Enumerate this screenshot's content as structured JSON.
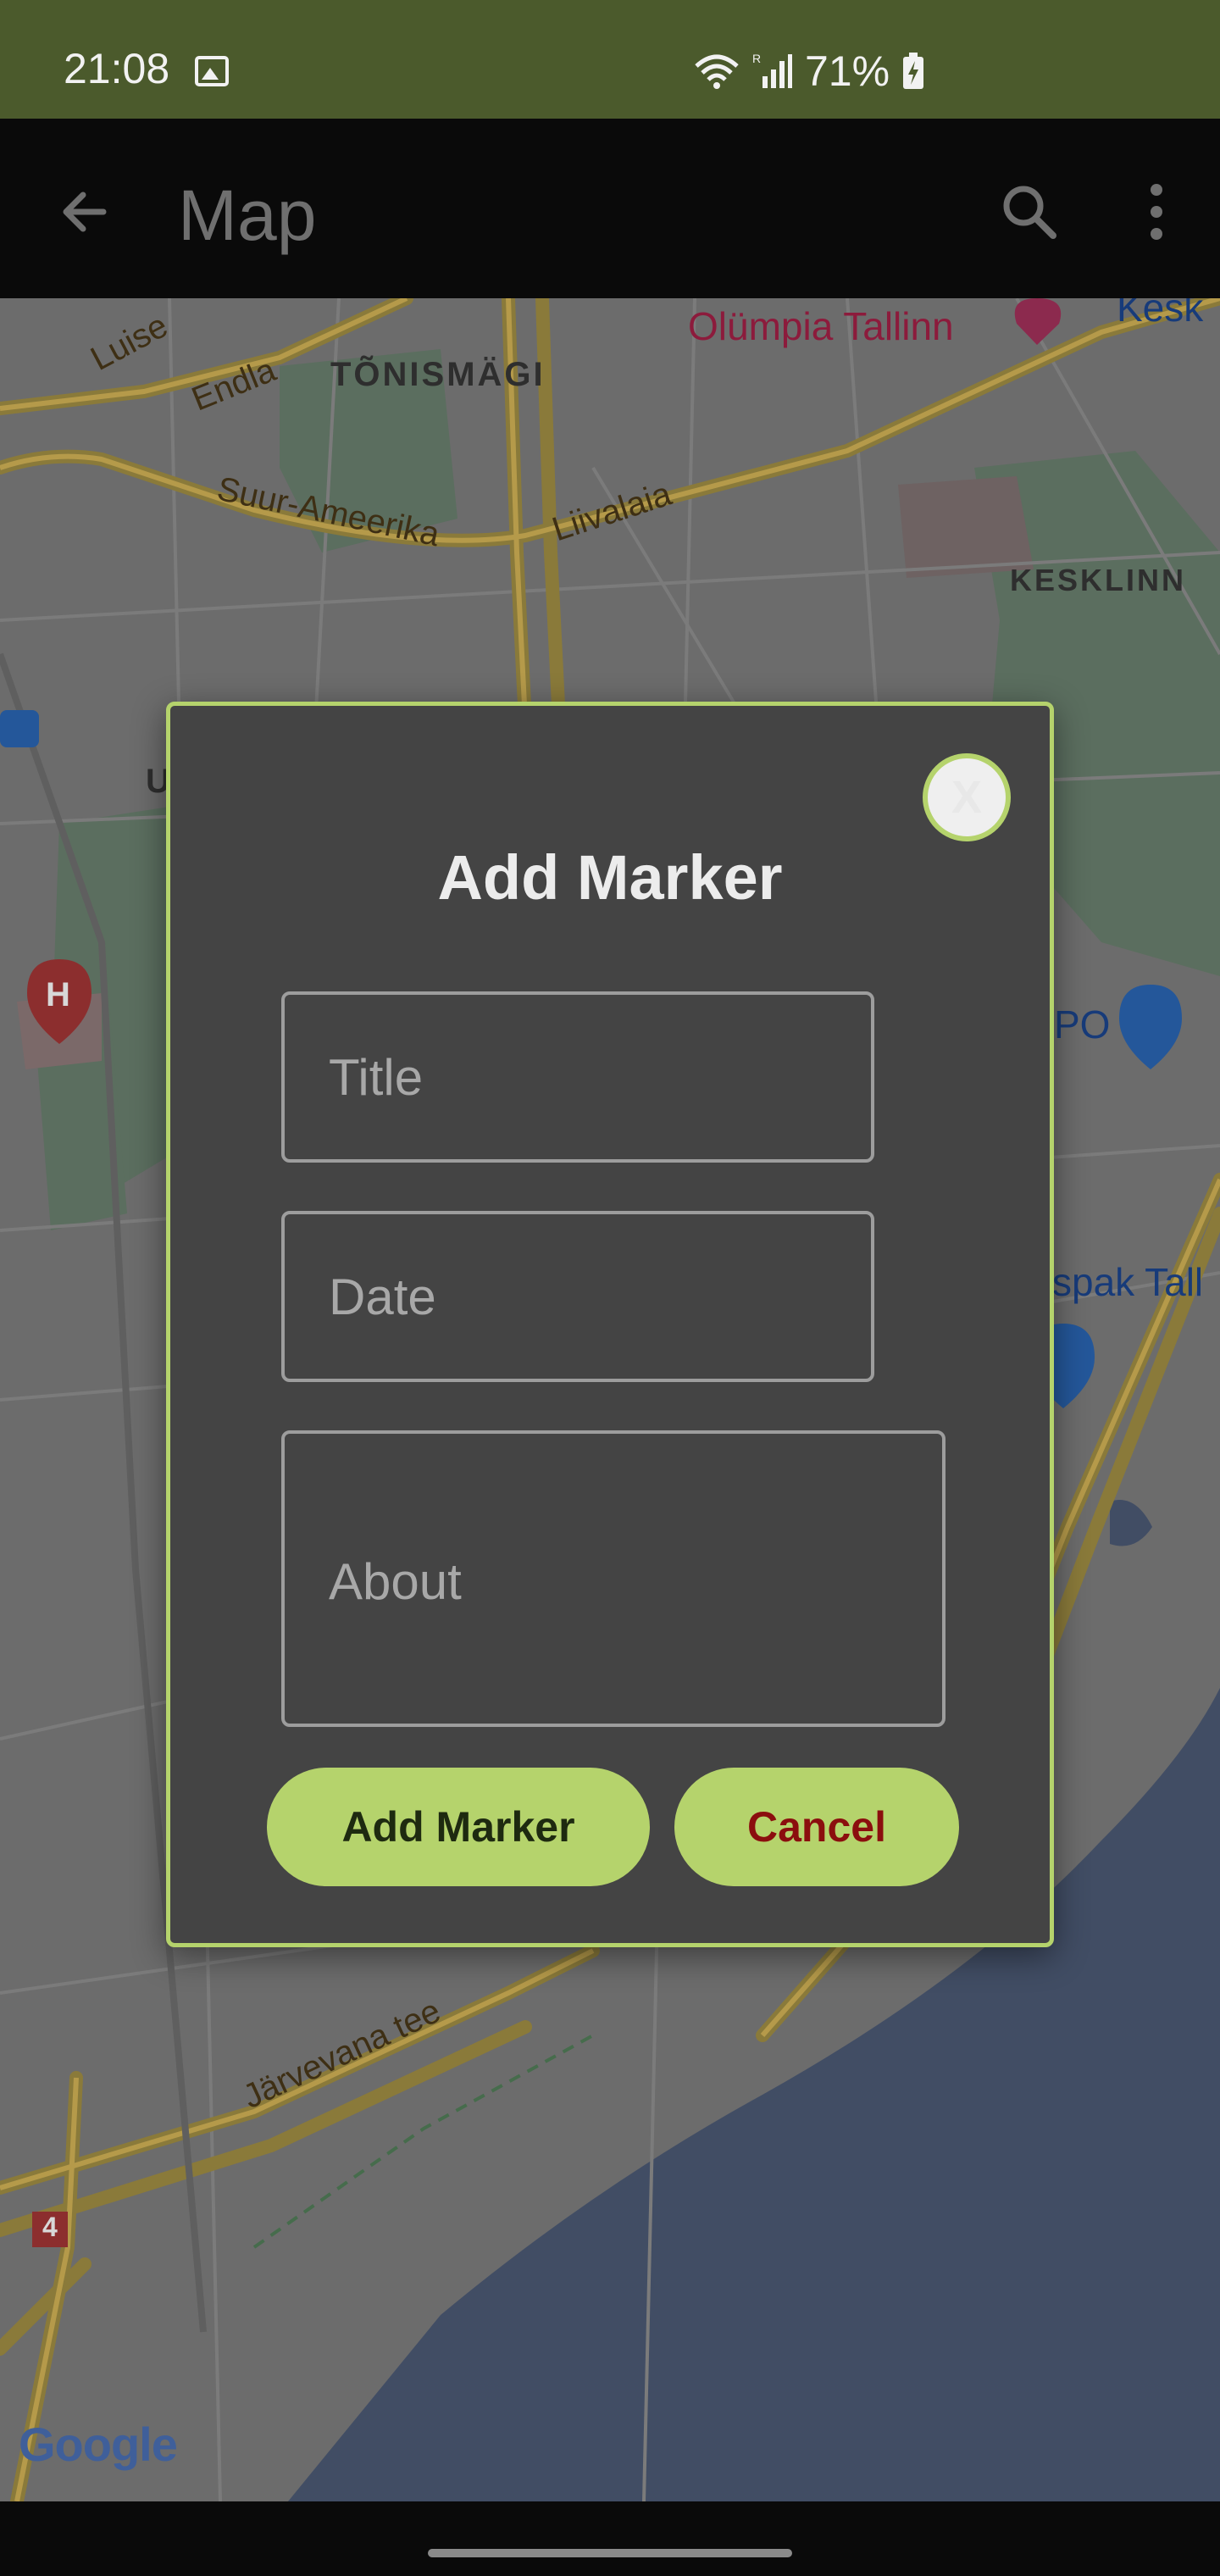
{
  "status_bar": {
    "time": "21:08",
    "battery": "71%",
    "icons": [
      "image-icon",
      "wifi-icon",
      "signal-icon",
      "battery-charging-icon"
    ]
  },
  "app_bar": {
    "title": "Map",
    "icons": [
      "back-arrow-icon",
      "search-icon",
      "more-vert-icon"
    ]
  },
  "map": {
    "labels": {
      "luise": "Luise",
      "endla": "Endla",
      "tonismagi": "TÕNISMÄGI",
      "olumpia": "Olümpia Tallinn",
      "kesk": "Kesk",
      "suur_ameerika": "Suur-Ameerika",
      "liivalaia": "Liivalaia",
      "kesklinn": "KESKLINN",
      "u": "U",
      "po": "PO",
      "spak": "spak Tall",
      "jarvevana": "Järvevana tee",
      "route4": "4"
    },
    "attribution": "Google"
  },
  "dialog": {
    "close_label": "X",
    "title": "Add Marker",
    "title_placeholder": "Title",
    "date_placeholder": "Date",
    "about_placeholder": "About",
    "add_button": "Add Marker",
    "cancel_button": "Cancel"
  },
  "colors": {
    "status_bar": "#4b5a2c",
    "accent": "#b5d36c",
    "dialog_bg": "#444444",
    "cancel_text": "#8b0e0e"
  }
}
